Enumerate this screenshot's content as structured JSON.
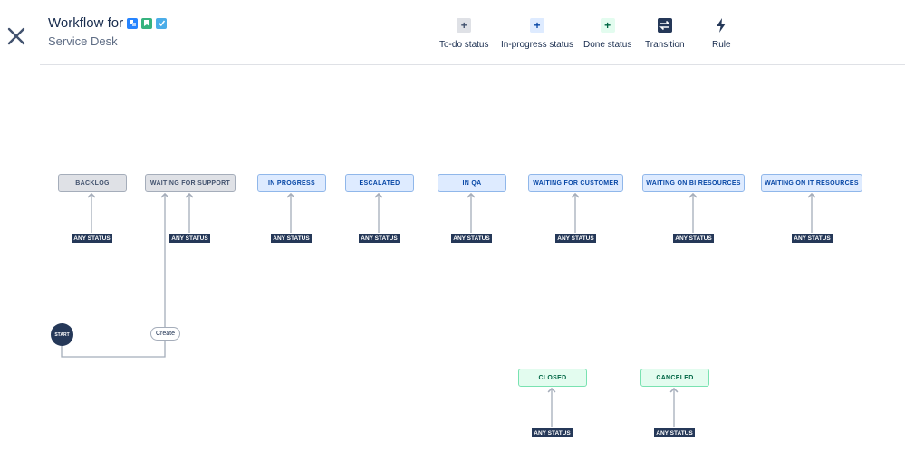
{
  "header": {
    "title": "Workflow for",
    "subtitle": "Service Desk",
    "title_icons": [
      "service-desk-icon",
      "bookmark-icon",
      "checkbox-icon"
    ]
  },
  "toolbar": {
    "todo_status": "To-do status",
    "inprogress_status": "In-progress status",
    "done_status": "Done status",
    "transition": "Transition",
    "rule": "Rule"
  },
  "statuses": {
    "backlog": "BACKLOG",
    "waiting_support": "WAITING FOR SUPPORT",
    "in_progress": "IN PROGRESS",
    "escalated": "ESCALATED",
    "in_qa": "IN QA",
    "waiting_customer": "WAITING FOR CUSTOMER",
    "waiting_bi": "WAITING ON BI RESOURCES",
    "waiting_it": "WAITING ON IT RESOURCES",
    "closed": "CLOSED",
    "canceled": "CANCELED"
  },
  "any_status": "ANY STATUS",
  "start": "START",
  "create": "Create",
  "colors": {
    "todo": "#dfe1e6",
    "in_progress": "#deebff",
    "done": "#e3fcef",
    "badge": "#253858",
    "line": "#a5adba"
  }
}
